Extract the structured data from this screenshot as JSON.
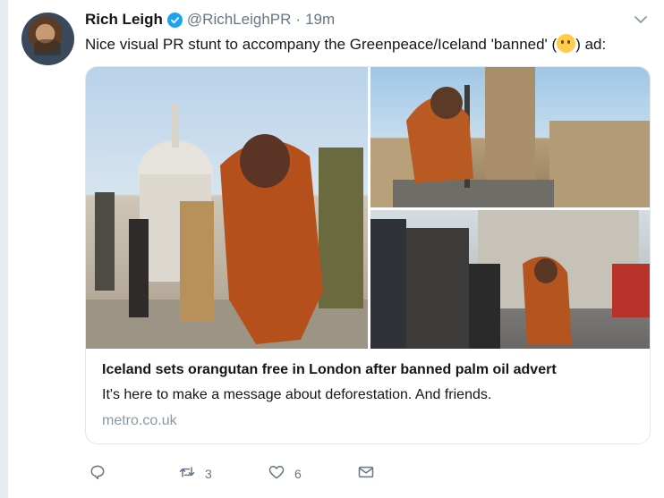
{
  "tweet": {
    "display_name": "Rich Leigh",
    "handle": "@RichLeighPR",
    "separator": "·",
    "time": "19m",
    "text_before_emoji": "Nice visual PR stunt to accompany the Greenpeace/Iceland 'banned' (",
    "text_after_emoji": ") ad:",
    "emoji_icon": "face-with-rolling-eyes-emoji"
  },
  "card": {
    "title": "Iceland sets orangutan free in London after banned palm oil advert",
    "description": "It's here to make a message about deforestation. And friends.",
    "domain": "metro.co.uk"
  },
  "actions": {
    "reply_count": "",
    "retweet_count": "3",
    "like_count": "6"
  },
  "colors": {
    "accent": "#1da1f2",
    "text": "#14171a",
    "muted": "#657786",
    "border": "#e1e8ed"
  }
}
